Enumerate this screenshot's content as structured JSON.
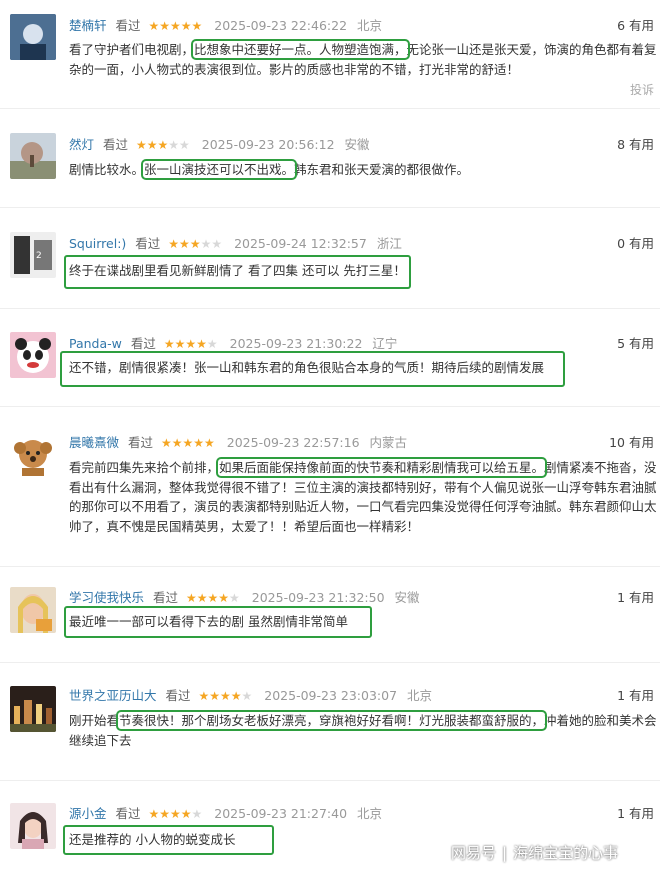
{
  "reviews": [
    {
      "user": "楚楠轩",
      "watched": "看过",
      "stars": 5,
      "date": "2025-09-23 22:46:22",
      "location": "北京",
      "useful": "6 有用",
      "text_before": "看了守护者们电视剧，",
      "highlight": "比想象中还要好一点。人物塑造饱满，",
      "text_after": "无论张一山还是张天爱，饰演的角色都有着复杂的一面，小人物式的表演很到位。影片的质感也非常的不错，打光非常的舒适！",
      "report": "投诉"
    },
    {
      "user": "然灯",
      "watched": "看过",
      "stars": 3,
      "date": "2025-09-23 20:56:12",
      "location": "安徽",
      "useful": "8 有用",
      "text_before": "剧情比较水。",
      "highlight": "张一山演技还可以不出戏。",
      "text_after": "韩东君和张天爱演的都很做作。"
    },
    {
      "user": "Squirrel:)",
      "watched": "看过",
      "stars": 3,
      "date": "2025-09-24 12:32:57",
      "location": "浙江",
      "useful": "0 有用",
      "highlight": "终于在谍战剧里看见新鲜剧情了 看了四集 还可以 先打三星！"
    },
    {
      "user": "Panda-w",
      "watched": "看过",
      "stars": 4,
      "date": "2025-09-23 21:30:22",
      "location": "辽宁",
      "useful": "5 有用",
      "highlight": "还不错，剧情很紧凑！张一山和韩东君的角色很贴合本身的气质！期待后续的剧情发展"
    },
    {
      "user": "晨曦熹微",
      "watched": "看过",
      "stars": 5,
      "date": "2025-09-23 22:57:16",
      "location": "内蒙古",
      "useful": "10 有用",
      "text_before": "看完前四集先来拾个前排，",
      "highlight": "如果后面能保持像前面的快节奏和精彩剧情我可以给五星。",
      "text_after": "剧情紧凑不拖沓，没看出有什么漏洞，整体我觉得很不错了！三位主演的演技都特别好，带有个人偏见说张一山浮夸韩东君油腻的那你可以不用看了，演员的表演都特别贴近人物，一口气看完四集没觉得任何浮夸油腻。韩东君颜仰山太帅了，真不愧是民国精英男，太爱了！！希望后面也一样精彩！"
    },
    {
      "user": "学习使我快乐",
      "watched": "看过",
      "stars": 4,
      "date": "2025-09-23 21:32:50",
      "location": "安徽",
      "useful": "1 有用",
      "highlight": "最近唯一一部可以看得下去的剧 虽然剧情非常简单"
    },
    {
      "user": "世界之亚历山大",
      "watched": "看过",
      "stars": 4,
      "date": "2025-09-23 23:03:07",
      "location": "北京",
      "useful": "1 有用",
      "text_before": "刚开始看",
      "highlight": "节奏很快！那个剧场女老板好漂亮，穿旗袍好好看啊！灯光服装都蛮舒服的，",
      "text_after": "冲着她的脸和美术会继续追下去"
    },
    {
      "user": "源小金",
      "watched": "看过",
      "stars": 4,
      "date": "2025-09-23 21:27:40",
      "location": "北京",
      "useful": "1 有用",
      "highlight": "还是推荐的 小人物的蜕变成长"
    }
  ],
  "watermark": {
    "brand": "网易号",
    "separator": "|",
    "account": "海绵宝宝的心事"
  },
  "colors": {
    "highlight_border": "#2e9e3f",
    "username": "#3377aa",
    "star": "#f5a623"
  }
}
